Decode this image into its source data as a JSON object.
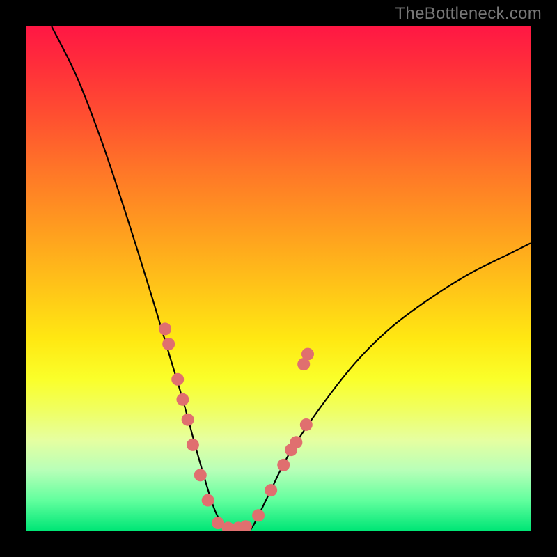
{
  "watermark": "TheBottleneck.com",
  "chart_data": {
    "type": "line",
    "title": "",
    "xlabel": "",
    "ylabel": "",
    "x_range": [
      0,
      100
    ],
    "y_range": [
      0,
      100
    ],
    "background": "rainbow-gradient (red top → green bottom)",
    "curve": {
      "description": "V-shaped bottleneck curve; left branch steep, right branch shallower; minimum near x≈40, y≈0",
      "points_xy": [
        [
          5,
          100
        ],
        [
          10,
          90
        ],
        [
          15,
          77
        ],
        [
          20,
          62
        ],
        [
          25,
          46
        ],
        [
          28,
          36
        ],
        [
          31,
          26
        ],
        [
          34,
          15
        ],
        [
          37,
          5
        ],
        [
          39,
          1
        ],
        [
          40,
          0
        ],
        [
          41,
          0
        ],
        [
          42,
          0
        ],
        [
          43,
          0
        ],
        [
          44,
          0
        ],
        [
          45,
          1
        ],
        [
          48,
          7
        ],
        [
          52,
          15
        ],
        [
          58,
          24
        ],
        [
          65,
          33
        ],
        [
          72,
          40
        ],
        [
          80,
          46
        ],
        [
          88,
          51
        ],
        [
          96,
          55
        ],
        [
          100,
          57
        ]
      ]
    },
    "scatter": {
      "color": "#e06f6f",
      "radius": 9,
      "points_xy": [
        [
          27.5,
          40
        ],
        [
          28.2,
          37
        ],
        [
          30.0,
          30
        ],
        [
          31.0,
          26
        ],
        [
          32.0,
          22
        ],
        [
          33.0,
          17
        ],
        [
          34.5,
          11
        ],
        [
          36.0,
          6
        ],
        [
          38.0,
          1.5
        ],
        [
          40.0,
          0.5
        ],
        [
          42.0,
          0.5
        ],
        [
          43.5,
          0.8
        ],
        [
          46.0,
          3
        ],
        [
          48.5,
          8
        ],
        [
          51.0,
          13
        ],
        [
          52.5,
          16
        ],
        [
          53.5,
          17.5
        ],
        [
          55.5,
          21
        ],
        [
          55.0,
          33
        ],
        [
          55.8,
          35
        ]
      ]
    }
  }
}
